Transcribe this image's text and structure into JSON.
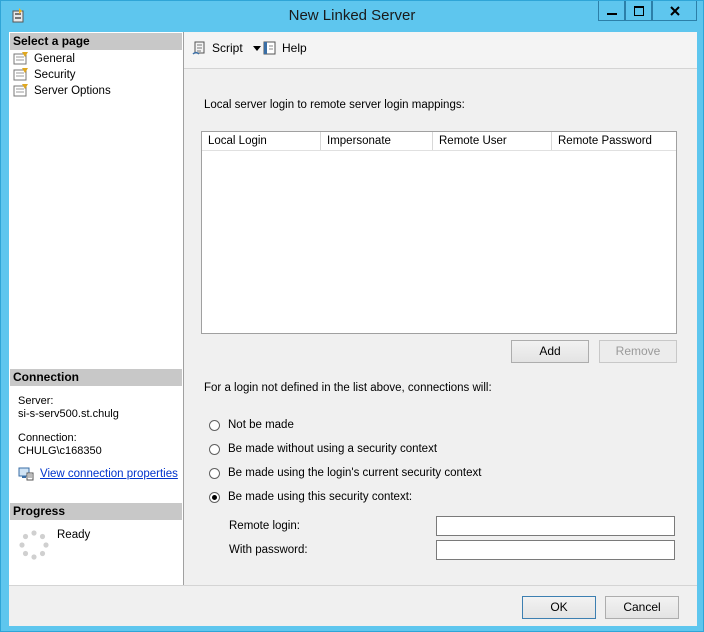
{
  "window": {
    "title": "New Linked Server"
  },
  "left": {
    "select_page_header": "Select a page",
    "pages": [
      {
        "label": "General"
      },
      {
        "label": "Security"
      },
      {
        "label": "Server Options"
      }
    ],
    "connection_header": "Connection",
    "server_label": "Server:",
    "server_value": "si-s-serv500.st.chulg",
    "connection_label": "Connection:",
    "connection_value": "CHULG\\c168350",
    "view_props_link": "View connection properties",
    "progress_header": "Progress",
    "progress_status": "Ready"
  },
  "toolbar": {
    "script_label": "Script",
    "help_label": "Help"
  },
  "main": {
    "mappings_label": "Local server login to remote server login mappings:",
    "columns": [
      "Local Login",
      "Impersonate",
      "Remote User",
      "Remote Password"
    ],
    "add_label": "Add",
    "remove_label": "Remove",
    "connections_label": "For a login not defined in the list above, connections will:",
    "options": [
      {
        "label": "Not be made",
        "selected": false
      },
      {
        "label": "Be made without using a security context",
        "selected": false
      },
      {
        "label": "Be made using the login's current security context",
        "selected": false
      },
      {
        "label": "Be made using this security context:",
        "selected": true
      }
    ],
    "remote_login_label": "Remote login:",
    "remote_login_value": "",
    "password_label": "With password:",
    "password_value": ""
  },
  "footer": {
    "ok_label": "OK",
    "cancel_label": "Cancel"
  }
}
